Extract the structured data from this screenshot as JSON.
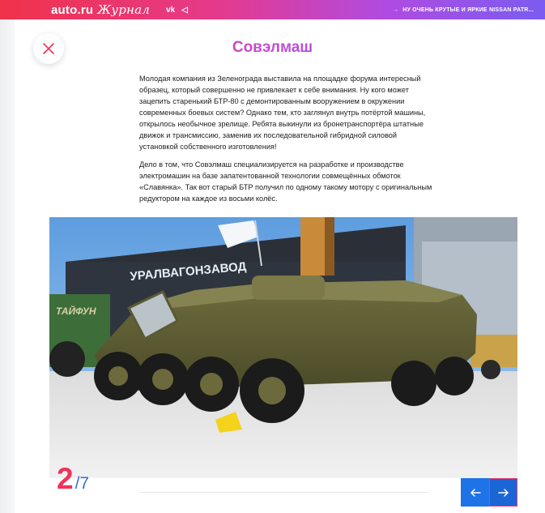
{
  "header": {
    "logo_main": "auto.ru",
    "logo_script": "Журнал",
    "social_1": "vk",
    "social_2": "◁",
    "news_arrow": "→",
    "news_link": "НУ ОЧЕНЬ КРУТЫЕ И ЯРКИЕ NISSAN PATR..."
  },
  "article": {
    "title": "Совэлмаш",
    "paragraphs": [
      "Молодая компания из Зеленограда выставила на площадке форума интересный образец, который совершенно не привлекает к себе внимания. Ну кого может зацепить старенький БТР-80 с демонтированным вооружением в окружении современных боевых систем? Однако тем, кто заглянул внутрь потёртой машины, открылось необычное зрелище. Ребята выкинули из бронетранспортёра штатные движок и трансмиссию, заменив их последовательной гибридной силовой установкой собственного изготовления!",
      "Дело в том, что Совэлмаш специализируется на разработке и производстве электромашин на базе запатентованной технологии совмещённых обмоток «Славянка». Так вот старый БТР получил по одному такому мотору с оригинальным редуктором на каждое из восьми колёс."
    ]
  },
  "photo": {
    "sign_text": "УРАЛВАГОНЗАВОД",
    "side_text": "ТАЙФУН"
  },
  "gallery": {
    "current": "2",
    "total": "/7"
  },
  "colors": {
    "accent_red": "#f0325a",
    "accent_blue": "#1e73e6"
  }
}
